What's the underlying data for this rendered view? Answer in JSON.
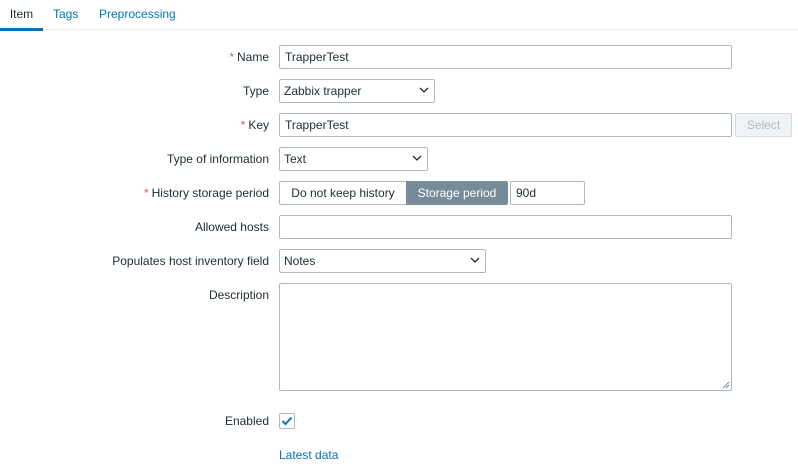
{
  "tabs": [
    {
      "label": "Item",
      "active": true
    },
    {
      "label": "Tags",
      "active": false
    },
    {
      "label": "Preprocessing",
      "active": false
    }
  ],
  "form": {
    "name": {
      "label": "Name",
      "required": true,
      "value": "TrapperTest"
    },
    "type": {
      "label": "Type",
      "value": "Zabbix trapper"
    },
    "key": {
      "label": "Key",
      "required": true,
      "value": "TrapperTest",
      "select_label": "Select"
    },
    "type_of_information": {
      "label": "Type of information",
      "value": "Text"
    },
    "history": {
      "label": "History storage period",
      "required": true,
      "option_off": "Do not keep history",
      "option_on": "Storage period",
      "value": "90d"
    },
    "allowed_hosts": {
      "label": "Allowed hosts",
      "value": ""
    },
    "inventory": {
      "label": "Populates host inventory field",
      "value": "Notes"
    },
    "description": {
      "label": "Description",
      "value": ""
    },
    "enabled": {
      "label": "Enabled",
      "checked": true
    }
  },
  "links": {
    "latest_data": "Latest data"
  },
  "colors": {
    "accent": "#0275b8",
    "required": "#e45959",
    "active_segment": "#768d99"
  }
}
